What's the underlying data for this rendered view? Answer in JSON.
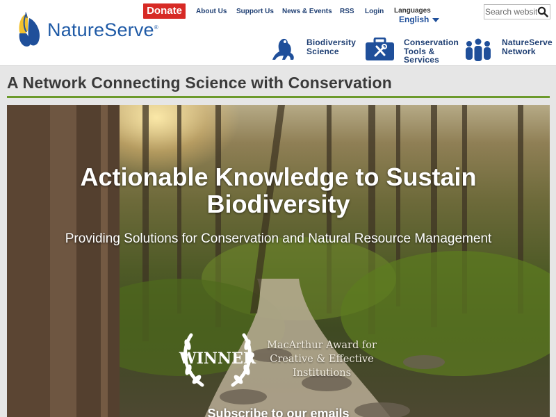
{
  "header": {
    "logo_text": "NatureServe",
    "logo_mark": "®",
    "donate_label": "Donate",
    "top_links": [
      "About Us",
      "Support Us",
      "News & Events",
      "RSS",
      "Login"
    ],
    "languages_label": "Languages",
    "language_value": "English",
    "search_placeholder": "Search website",
    "nav": [
      {
        "line1": "Biodiversity",
        "line2": "Science",
        "line3": "",
        "icon": "frog-icon"
      },
      {
        "line1": "Conservation",
        "line2": "Tools &",
        "line3": "Services",
        "icon": "toolbox-icon"
      },
      {
        "line1": "NatureServe",
        "line2": "Network",
        "line3": "",
        "icon": "people-group-icon"
      }
    ]
  },
  "page_title": "A Network Connecting Science with Conservation",
  "hero": {
    "heading": "Actionable Knowledge to Sustain Biodiversity",
    "subheading": "Providing Solutions for Conservation and Natural Resource Management",
    "award_badge": "WINNER",
    "award_text": "MacArthur Award for Creative & Effective Institutions",
    "subscribe": "Subscribe to our emails"
  },
  "colors": {
    "brand_blue": "#1f3f73",
    "donate_red": "#d72a25",
    "title_rule_green": "#6c9a2c"
  }
}
